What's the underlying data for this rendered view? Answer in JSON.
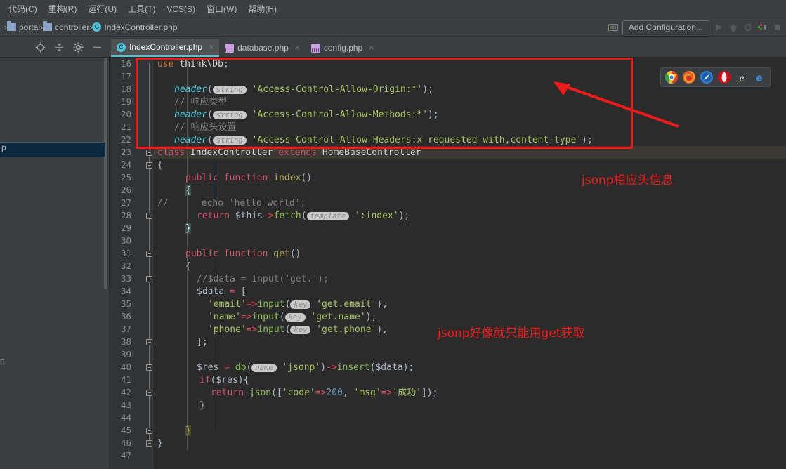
{
  "menubar": {
    "items": [
      {
        "label": "代码(C)",
        "name": "menu-code"
      },
      {
        "label": "重构(R)",
        "name": "menu-refactor"
      },
      {
        "label": "运行(U)",
        "name": "menu-run"
      },
      {
        "label": "工具(T)",
        "name": "menu-tools"
      },
      {
        "label": "VCS(S)",
        "name": "menu-vcs"
      },
      {
        "label": "窗口(W)",
        "name": "menu-window"
      },
      {
        "label": "帮助(H)",
        "name": "menu-help"
      }
    ]
  },
  "breadcrumb": {
    "items": [
      "portal",
      "controller",
      "IndexController.php"
    ],
    "separator": "›"
  },
  "toolbar": {
    "add_configuration": "Add Configuration...",
    "icons": [
      "screen-icon",
      "run-icon",
      "debug-icon",
      "rerun-icon",
      "coverage-icon",
      "stop-icon"
    ]
  },
  "tabs": [
    {
      "label": "IndexController.php",
      "icon": "php-class-icon",
      "active": true,
      "close": "×"
    },
    {
      "label": "database.php",
      "icon": "php-config-icon",
      "active": false,
      "close": "×"
    },
    {
      "label": "config.php",
      "icon": "php-config-icon",
      "active": false,
      "close": "×"
    }
  ],
  "editor_toolbar_icons": [
    "locate-icon",
    "collapse-icon",
    "settings-icon",
    "hide-icon"
  ],
  "left_panel": {
    "selected_fragment": "p",
    "item_fragment": "n"
  },
  "editor": {
    "first_line": 16,
    "last_line": 47,
    "lines": [
      {
        "n": 16,
        "text": "use think\\Db;"
      },
      {
        "n": 17,
        "text": ""
      },
      {
        "n": 18,
        "text": "header( string 'Access-Control-Allow-Origin:*');"
      },
      {
        "n": 19,
        "text": "// 响应类型"
      },
      {
        "n": 20,
        "text": "header( string 'Access-Control-Allow-Methods:*');"
      },
      {
        "n": 21,
        "text": "// 响应头设置"
      },
      {
        "n": 22,
        "text": "header( string 'Access-Control-Allow-Headers:x-requested-with,content-type');"
      },
      {
        "n": 23,
        "text": "class IndexController extends HomeBaseController"
      },
      {
        "n": 24,
        "text": "{"
      },
      {
        "n": 25,
        "text": "public function index()"
      },
      {
        "n": 26,
        "text": "{"
      },
      {
        "n": 27,
        "text": "//      echo 'hello world';"
      },
      {
        "n": 28,
        "text": "return $this->fetch( template ':index');"
      },
      {
        "n": 29,
        "text": "}"
      },
      {
        "n": 30,
        "text": ""
      },
      {
        "n": 31,
        "text": "public function get()"
      },
      {
        "n": 32,
        "text": "{"
      },
      {
        "n": 33,
        "text": "//$data = input('get.');"
      },
      {
        "n": 34,
        "text": "$data = ["
      },
      {
        "n": 35,
        "text": "'email'=>input( key 'get.email'),"
      },
      {
        "n": 36,
        "text": "'name'=>input( key 'get.name'),"
      },
      {
        "n": 37,
        "text": "'phone'=>input( key 'get.phone'),"
      },
      {
        "n": 38,
        "text": "];"
      },
      {
        "n": 39,
        "text": ""
      },
      {
        "n": 40,
        "text": "$res = db( name 'jsonp')->insert($data);"
      },
      {
        "n": 41,
        "text": "if($res){"
      },
      {
        "n": 42,
        "text": "return json(['code'=>200, 'msg'=>'成功']);"
      },
      {
        "n": 43,
        "text": "}"
      },
      {
        "n": 44,
        "text": ""
      },
      {
        "n": 45,
        "text": "}"
      },
      {
        "n": 46,
        "text": "}"
      },
      {
        "n": 47,
        "text": ""
      }
    ],
    "param_hints": [
      "string",
      "template",
      "key",
      "name"
    ],
    "highlighted_line": 29
  },
  "annotations": [
    {
      "text": "jsonp相应头信息",
      "name": "annotation-jsonp-headers",
      "color": "#ee1b1b"
    },
    {
      "text": "jsonp好像就只能用get获取",
      "name": "annotation-jsonp-get",
      "color": "#ee1b1b"
    }
  ],
  "browser_bar": {
    "browsers": [
      {
        "name": "chrome-icon",
        "color": "#e8e8e8"
      },
      {
        "name": "firefox-icon",
        "color": "#e66000"
      },
      {
        "name": "safari-icon",
        "color": "#3a8ee6"
      },
      {
        "name": "opera-icon",
        "color": "#cc0f16"
      },
      {
        "name": "internet-explorer-icon",
        "color": "#cfe6cc"
      },
      {
        "name": "edge-icon",
        "color": "#3d8ee0"
      }
    ]
  },
  "colors": {
    "accent": "#4fc3d9",
    "annotation": "#ee1b1b",
    "editor_bg": "#2b2b2b",
    "chrome_bg": "#3c3f41",
    "selection": "#0d293e"
  }
}
